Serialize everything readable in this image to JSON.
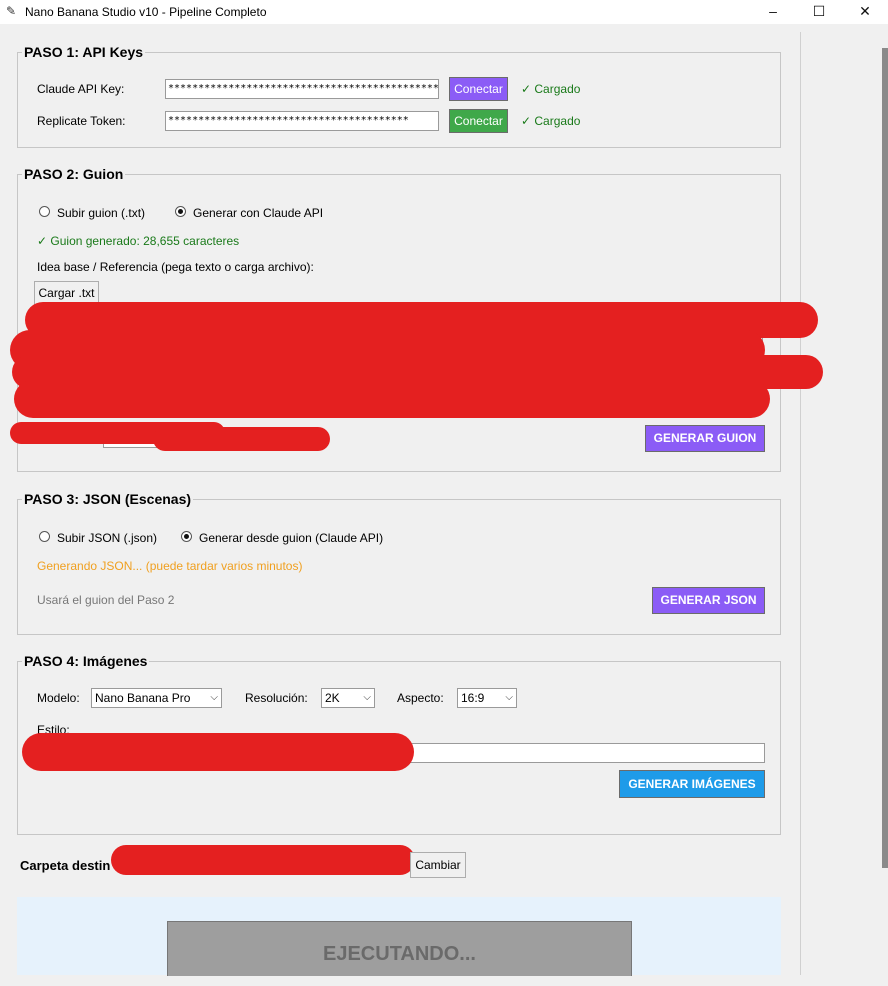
{
  "window": {
    "title": "Nano Banana Studio v10 - Pipeline Completo",
    "icon": "feather-icon",
    "min": "–",
    "max": "☐",
    "close": "✕"
  },
  "paso1": {
    "title": "PASO 1: API Keys",
    "claude_label": "Claude API Key:",
    "claude_value": "**********************************************************",
    "replicate_label": "Replicate Token:",
    "replicate_value": "****************************************",
    "connect_label": "Conectar",
    "status": "✓ Cargado"
  },
  "paso2": {
    "title": "PASO 2: Guion",
    "radio1": "Subir guion (.txt)",
    "radio2": "Generar con Claude API",
    "generated": "✓ Guion generado: 28,655 caracteres",
    "idea_label": "Idea base / Referencia (pega texto o carga archivo):",
    "load_btn": "Cargar .txt",
    "generate_btn": "GENERAR GUION"
  },
  "paso3": {
    "title": "PASO 3: JSON (Escenas)",
    "radio1": "Subir JSON (.json)",
    "radio2": "Generar desde guion (Claude API)",
    "generating": "Generando JSON... (puede tardar varios minutos)",
    "hint": "Usará el guion del Paso 2",
    "generate_btn": "GENERAR JSON"
  },
  "paso4": {
    "title": "PASO 4: Imágenes",
    "model_label": "Modelo:",
    "model_value": "Nano Banana Pro",
    "res_label": "Resolución:",
    "res_value": "2K",
    "aspect_label": "Aspecto:",
    "aspect_value": "16:9",
    "style_label": "Estilo:",
    "generate_btn": "GENERAR IMÁGENES"
  },
  "folder": {
    "label": "Carpeta destin",
    "change_btn": "Cambiar"
  },
  "run": {
    "label": "EJECUTANDO..."
  },
  "colors": {
    "purple": "#8b5cf6",
    "green": "#3fa84a",
    "blue": "#1e9be9",
    "ok": "#1a7a1a",
    "warn": "#f0a020",
    "redaction": "#e42020"
  }
}
